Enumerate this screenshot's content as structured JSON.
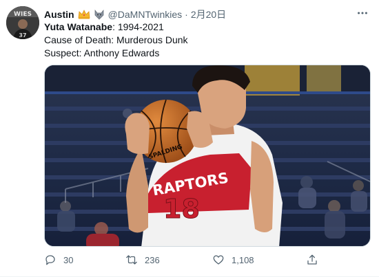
{
  "tweet": {
    "author": {
      "display_name": "Austin",
      "handle": "@DaMNTwinkies",
      "badge_icons": [
        "crown-emoji-icon",
        "wolf-emoji-icon"
      ]
    },
    "separator": "·",
    "date": "2月20日",
    "lines": [
      {
        "bold": "Yuta Watanabe",
        "rest": ": 1994-2021"
      },
      {
        "bold": "",
        "rest": "Cause of Death: Murderous Dunk"
      },
      {
        "bold": "",
        "rest": "Suspect: Anthony Edwards"
      }
    ],
    "media": {
      "jersey_word": "RAPTORS",
      "jersey_number": "18",
      "ball_brand": "SPALDING"
    },
    "actions": {
      "reply_count": "30",
      "retweet_count": "236",
      "like_count": "1,108"
    }
  },
  "colors": {
    "text_primary": "#0f1419",
    "text_secondary": "#536471",
    "jersey_red": "#c8202f",
    "court_blue": "#1d2a44"
  }
}
